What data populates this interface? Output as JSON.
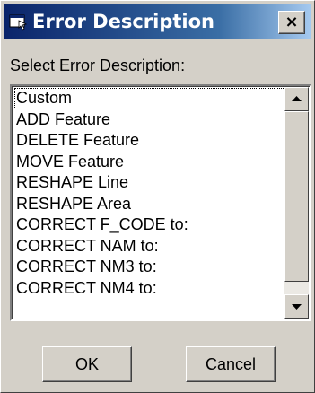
{
  "window": {
    "title": "Error Description",
    "close_glyph": "×",
    "icon": "window-app-icon"
  },
  "prompt": {
    "label": "Select Error Description:"
  },
  "listbox": {
    "selected_index": 0,
    "items": [
      "Custom",
      "ADD Feature",
      "DELETE Feature",
      "MOVE Feature",
      "RESHAPE Line",
      "RESHAPE Area",
      "CORRECT F_CODE to:",
      "CORRECT NAM to:",
      "CORRECT NM3 to:",
      "CORRECT NM4 to:"
    ]
  },
  "buttons": {
    "ok": "OK",
    "cancel": "Cancel"
  }
}
